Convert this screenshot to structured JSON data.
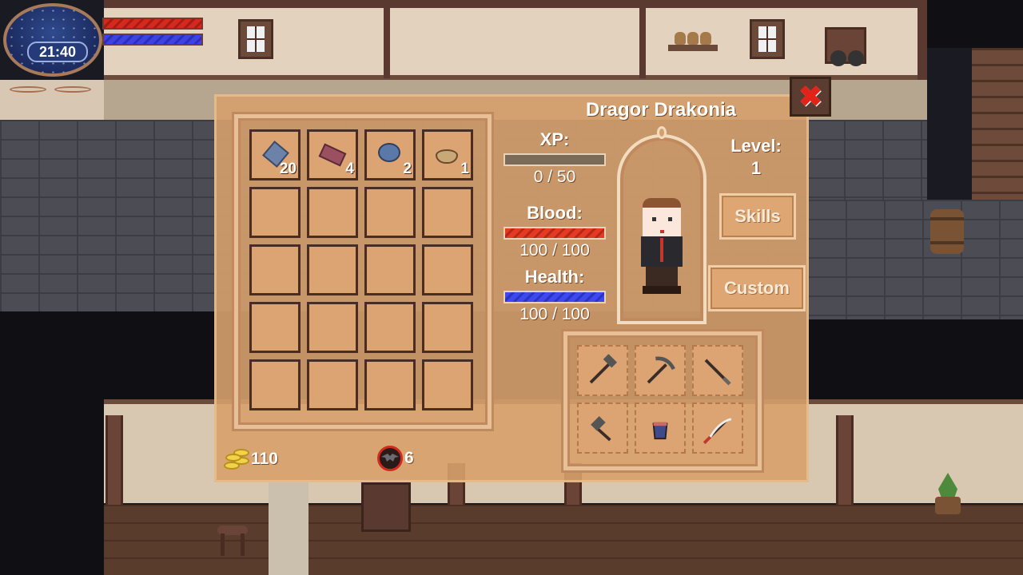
{
  "hud": {
    "time": "21:40",
    "blood_level": 1.0,
    "mana_level": 1.0,
    "colors": {
      "blood": "#d42a1e",
      "mana": "#3b43e6"
    }
  },
  "character": {
    "name": "Dragor Drakonia",
    "level_label": "Level:",
    "level": "1",
    "xp_label": "XP:",
    "xp_text": "0 / 50",
    "xp_fraction": 0.0,
    "blood_label": "Blood:",
    "blood_text": "100 / 100",
    "blood_fraction": 1.0,
    "health_label": "Health:",
    "health_text": "100 / 100",
    "health_fraction": 1.0
  },
  "buttons": {
    "skills": "Skills",
    "custom": "Custom",
    "close_icon": "close-x-icon"
  },
  "inventory": {
    "slots": [
      {
        "item": "stone-icon",
        "qty": "20"
      },
      {
        "item": "brick-icon",
        "qty": "4"
      },
      {
        "item": "ore-icon",
        "qty": "2"
      },
      {
        "item": "bowl-icon",
        "qty": "1"
      },
      {},
      {},
      {},
      {},
      {},
      {},
      {},
      {},
      {},
      {},
      {},
      {},
      {},
      {},
      {},
      {}
    ]
  },
  "tools": [
    {
      "icon": "hammer-icon"
    },
    {
      "icon": "pickaxe-icon"
    },
    {
      "icon": "staff-icon"
    },
    {
      "icon": "mallet-icon"
    },
    {
      "icon": "bucket-icon"
    },
    {
      "icon": "scythe-icon"
    }
  ],
  "currency": {
    "gold": "110",
    "gold_icon": "gold-coins-icon",
    "bat_tokens": "6",
    "bat_icon": "bat-badge-icon"
  }
}
